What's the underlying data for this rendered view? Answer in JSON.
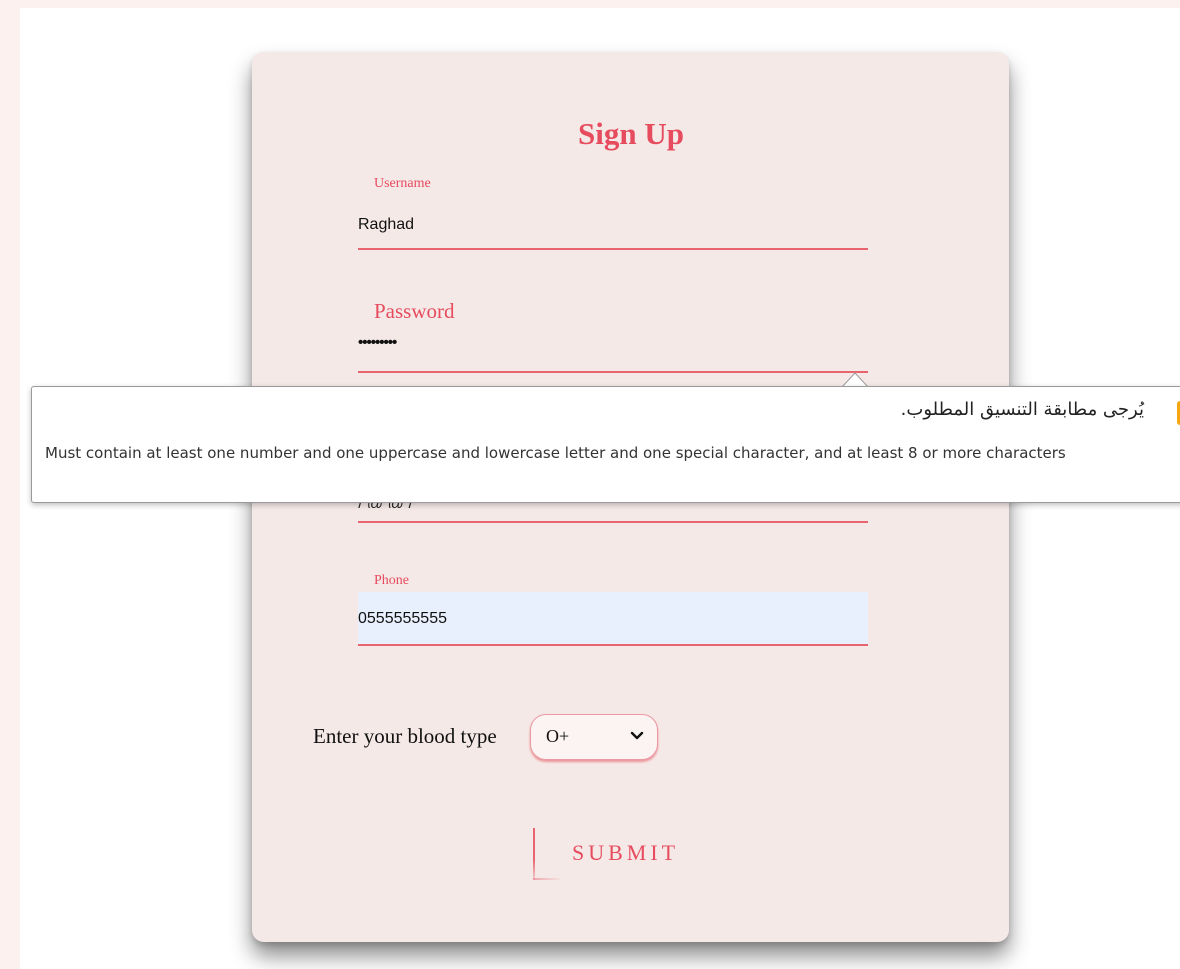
{
  "form": {
    "title": "Sign Up",
    "username": {
      "label": "Username",
      "value": "Raghad"
    },
    "password": {
      "label": "Password",
      "value": "•••••••••"
    },
    "email": {
      "partial_value": "/ @ @ /"
    },
    "phone": {
      "label": "Phone",
      "value": "0555555555"
    },
    "blood_type": {
      "label": "Enter your blood type",
      "selected": "O+"
    },
    "submit_label": "SUBMIT"
  },
  "validation_tooltip": {
    "title": "يُرجى مطابقة التنسيق المطلوب.",
    "message": "Must contain at least one number and one uppercase and lowercase letter and one special character, and at least 8 or more characters",
    "icon": "warning-icon",
    "icon_glyph": "!"
  },
  "colors": {
    "accent": "#e64b5e",
    "card": "#f5e9e7",
    "warning": "#f6a60f"
  }
}
